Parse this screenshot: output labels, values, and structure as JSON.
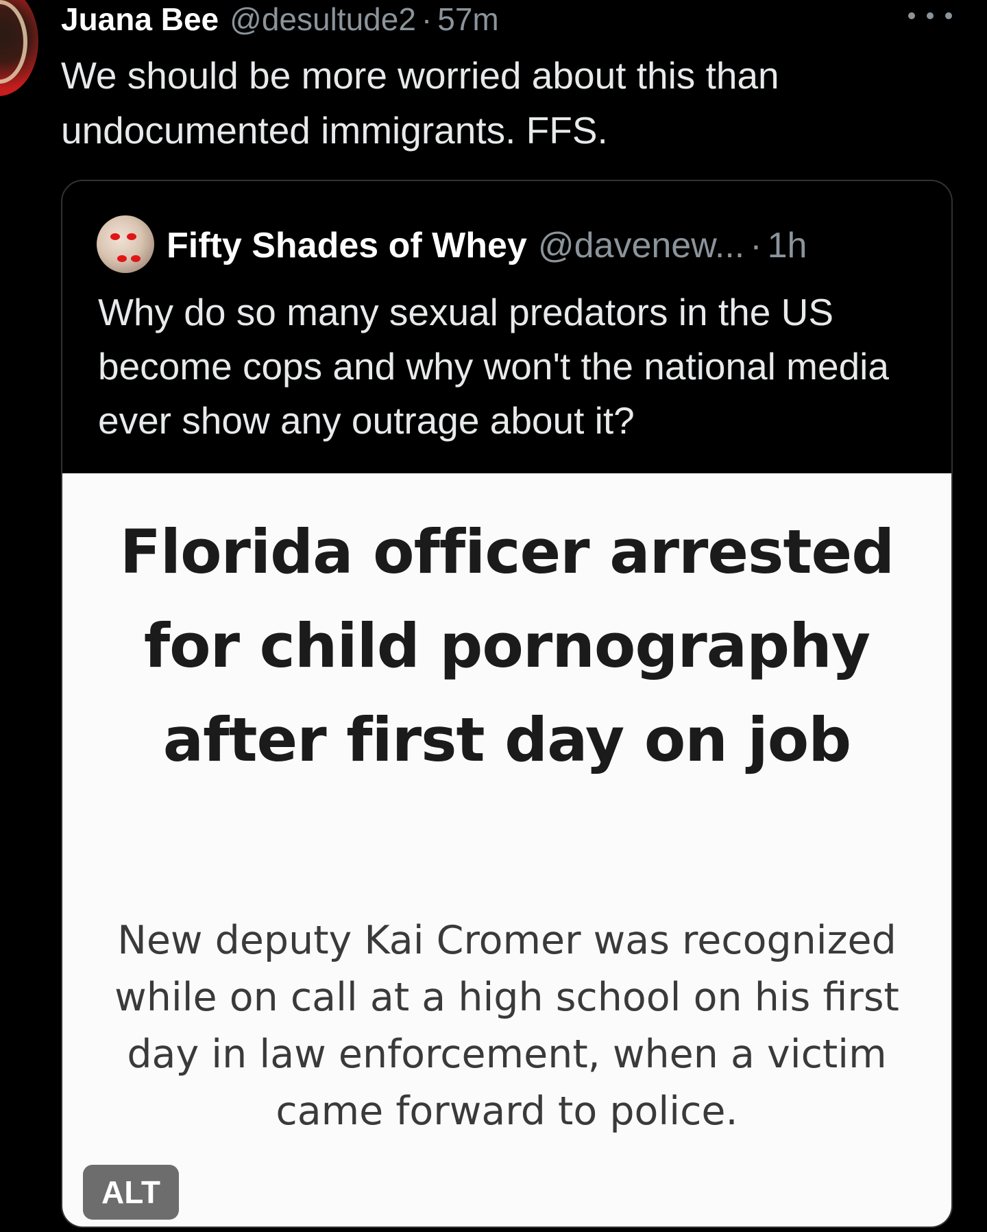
{
  "tweet": {
    "author_name": "Juana Bee",
    "author_handle": "@desultude2",
    "separator": "·",
    "time": "57m",
    "text": "We should be more worried about this than undocumented immigrants. FFS.",
    "more_icon": "more-horizontal-icon"
  },
  "quoted_tweet": {
    "author_name": "Fifty Shades of Whey",
    "author_handle": "@davenew...",
    "separator": "·",
    "time": "1h",
    "text": "Why do so many sexual predators in the US become cops and why won't the national media ever show any outrage about it?",
    "media": {
      "headline": "Florida officer arrested for child pornography after first day on job",
      "subhead": "New deputy Kai Cromer was recognized while on call at a high school on his first day in law enforcement, when a victim came forward to police.",
      "alt_label": "ALT"
    }
  },
  "colors": {
    "background": "#000000",
    "text_primary": "#e7e9ea",
    "text_secondary": "#8b949b",
    "border": "#2f3336",
    "media_background": "#fbfbfb",
    "headline": "#1b1b1b",
    "alt_badge": "#6d6d6d"
  }
}
